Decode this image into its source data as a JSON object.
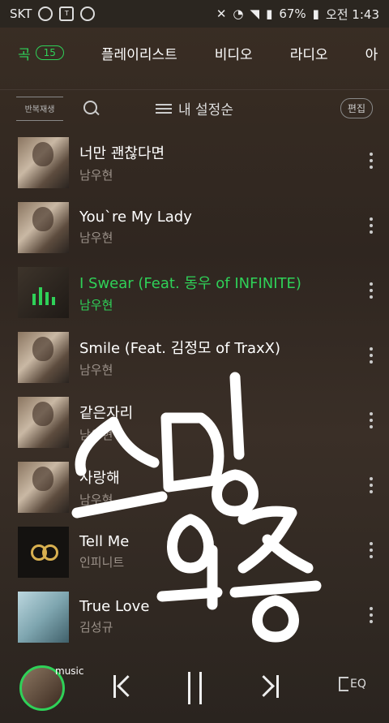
{
  "status": {
    "carrier": "SKT",
    "battery": "67%",
    "time": "오전 1:43"
  },
  "tabs": {
    "items": [
      {
        "label": "곡",
        "badge": "15",
        "active": true
      },
      {
        "label": "플레이리스트"
      },
      {
        "label": "비디오"
      },
      {
        "label": "라디오"
      },
      {
        "label": "아"
      }
    ]
  },
  "toolbar": {
    "repeat_label": "반복재생",
    "sort_label": "내 설정순",
    "edit_label": "편집"
  },
  "songs": [
    {
      "title": "너만 괜찮다면",
      "artist": "남우현",
      "thumb": "photo"
    },
    {
      "title": "You`re My Lady",
      "artist": "남우현",
      "thumb": "photo"
    },
    {
      "title": "I Swear (Feat. 동우 of INFINITE)",
      "artist": "남우현",
      "thumb": "playing",
      "active": true
    },
    {
      "title": "Smile (Feat. 김정모 of TraxX)",
      "artist": "남우현",
      "thumb": "photo"
    },
    {
      "title": "같은자리",
      "artist": "남우현",
      "thumb": "photo"
    },
    {
      "title": "사랑해",
      "artist": "남우현",
      "thumb": "photo"
    },
    {
      "title": "Tell Me",
      "artist": "인피니트",
      "thumb": "dark"
    },
    {
      "title": "True Love",
      "artist": "김성규",
      "thumb": "light"
    }
  ],
  "player": {
    "tag": "music",
    "eq_label": "EQ"
  },
  "colors": {
    "accent": "#2fd158",
    "background": "#2f2620"
  }
}
